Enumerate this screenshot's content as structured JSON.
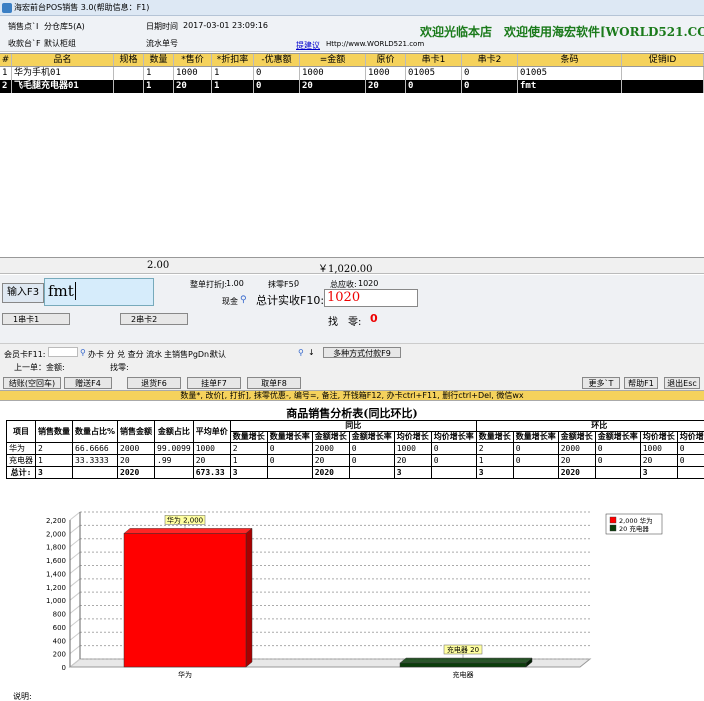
{
  "window": {
    "title": "海宏前台POS销售 3.0(帮助信息：F1)"
  },
  "header": {
    "sale_point_label": "销售点`I",
    "sale_point_value": "分仓库5(A)",
    "date_label": "日期时间",
    "date_value": "2017-03-01 23:09:16",
    "cashier_label": "收款台`F",
    "cashier_value": "默认柜组",
    "serial_label": "流水单号",
    "serial_value": "",
    "suggest_label": "提建议",
    "suggest_url": "Http://www.WORLD521.com",
    "welcome": "欢迎光临本店　欢迎使用海宏软件[WORLD521.COM"
  },
  "grid": {
    "columns": [
      "#",
      "品名",
      "规格",
      "数量",
      "*售价",
      "*折扣率",
      "-优惠额",
      "=金额",
      "原价",
      "串卡1",
      "串卡2",
      "条码",
      "促销ID"
    ],
    "rows": [
      [
        "1",
        "华为手机01",
        "",
        "1",
        "1000",
        "1",
        "0",
        "1000",
        "1000",
        "01005",
        "0",
        "01005",
        ""
      ],
      [
        "2",
        "飞毛腿充电器01",
        "",
        "1",
        "20",
        "1",
        "0",
        "20",
        "20",
        "0",
        "0",
        "fmt",
        ""
      ]
    ],
    "total_qty": "2.00",
    "total_amount": "￥1,020.00"
  },
  "input": {
    "label": "输入F3",
    "value": "fmt",
    "discount_label": "整单打折J:",
    "discount_value": "1.00",
    "round_label": "抹零F5:",
    "round_value": "0",
    "receivable_label": "总应收:",
    "receivable_value": "1020",
    "cash_label": "现金",
    "total_paid_label": "总计实收F10:",
    "total_paid_value": "1020",
    "change_label": "找　零:",
    "change_value": "0",
    "card1_button": "1串卡1",
    "card2_button": "2串卡2"
  },
  "member": {
    "card_label": "会员卡F11:",
    "card_hint": "办卡 分 兑 查分 流水",
    "sales_label": "主销售PgDn:",
    "sales_value": "默认",
    "multi_pay_button": "多种方式付款F9",
    "last_order_label": "上一单：金额:",
    "change_label": "找零:"
  },
  "buttons": {
    "checkout": "结账(空回车)",
    "gift": "赠送F4",
    "return": "退货F6",
    "hold": "挂单F7",
    "retrieve": "取单F8",
    "more": "更多`T",
    "help": "帮助F1",
    "exit": "退出Esc"
  },
  "hint": "数量*, 改价[, 打折], 抹零优惠-, 编号=, 备注, 开钱箱F12, 办卡ctrl+F11, 删行ctrl+Del, 微信wx",
  "report": {
    "title": "商品销售分析表(同比环比)",
    "col_item": "项目",
    "col_qty": "销售数量",
    "col_qty_pct": "数量占比%",
    "col_amount": "销售金额",
    "col_amount_pct": "金额占比",
    "col_avg": "平均单价",
    "group_yoy": "同比",
    "group_mom": "环比",
    "sub_cols": [
      "数量增长",
      "数量增长率",
      "金额增长",
      "金额增长率",
      "均价增长",
      "均价增长率"
    ],
    "rows": [
      [
        "华为",
        "2",
        "66.6666",
        "2000",
        "99.0099",
        "1000",
        "2",
        "0",
        "2000",
        "0",
        "1000",
        "0",
        "2",
        "0",
        "2000",
        "0",
        "1000",
        "0"
      ],
      [
        "充电器",
        "1",
        "33.3333",
        "20",
        ".99",
        "20",
        "1",
        "0",
        "20",
        "0",
        "20",
        "0",
        "1",
        "0",
        "20",
        "0",
        "20",
        "0"
      ],
      [
        "总计:",
        "3",
        "",
        "2020",
        "",
        "673.33",
        "3",
        "",
        "2020",
        "",
        "3",
        "",
        "3",
        "",
        "2020",
        "",
        "3",
        ""
      ]
    ],
    "note_label": "说明:"
  },
  "chart_data": {
    "type": "bar",
    "categories": [
      "华为",
      "充电器"
    ],
    "values": [
      2000,
      20
    ],
    "data_labels": [
      "华为 2,000",
      "充电器 20"
    ],
    "ylim": [
      0,
      2200
    ],
    "yticks": [
      "0",
      "200",
      "400",
      "600",
      "800",
      "1,000",
      "1,200",
      "1,400",
      "1,600",
      "1,800",
      "2,000",
      "2,200"
    ],
    "colors": [
      "#ff0000",
      "#0a3d0a"
    ],
    "legend": [
      "2,000 华为",
      "20 充电器"
    ],
    "legend_position": "top-right",
    "grid": true
  }
}
